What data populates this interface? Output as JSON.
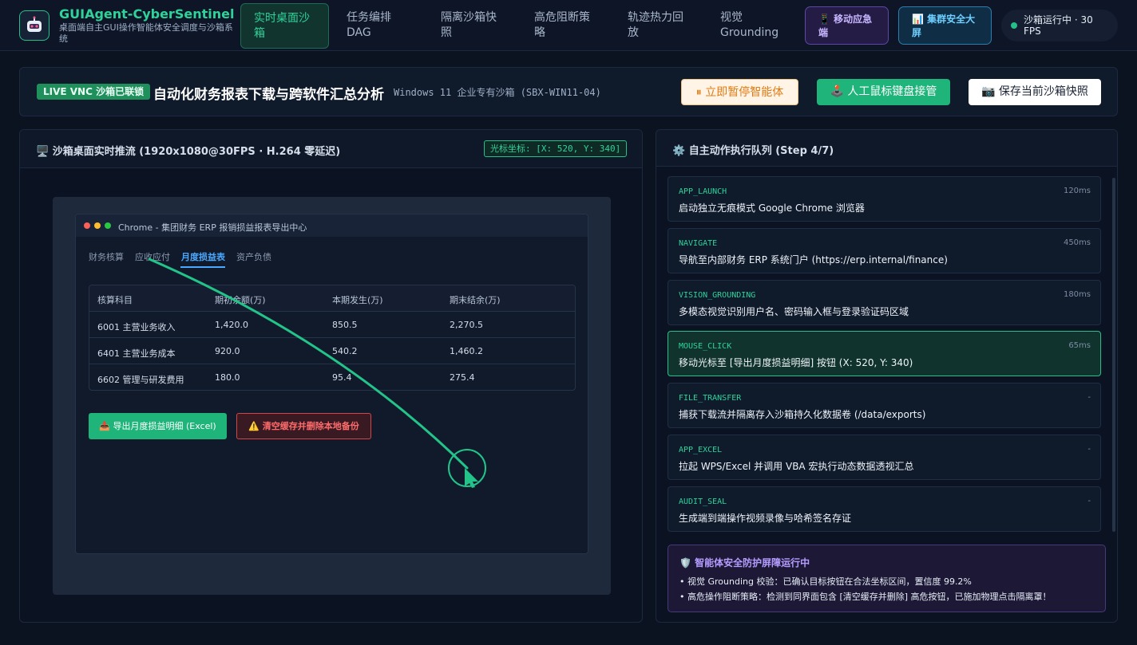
{
  "brand": {
    "title": "GUIAgent-CyberSentinel",
    "subtitle": "桌面端自主GUI操作智能体安全调度与沙箱系统"
  },
  "nav": {
    "items": [
      {
        "label": "实时桌面沙箱",
        "active": true
      },
      {
        "label": "任务编排 DAG",
        "active": false
      },
      {
        "label": "隔离沙箱快照",
        "active": false
      },
      {
        "label": "高危阻断策略",
        "active": false
      },
      {
        "label": "轨迹热力回放",
        "active": false
      },
      {
        "label": "视觉 Grounding",
        "active": false
      }
    ],
    "mobile_label": "📱 移动应急端",
    "screen_label": "📊 集群安全大屏",
    "status_text": "沙箱运行中 · 30 FPS"
  },
  "banner": {
    "live_badge": "LIVE VNC 沙箱已联锁",
    "task_title": "自动化财务报表下载与跨软件汇总分析",
    "environment": "Windows 11 企业专有沙箱 (SBX-WIN11-04)",
    "pause_label": "⏸ 立即暂停智能体",
    "takeover_label": "🕹️ 人工鼠标键盘接管",
    "snapshot_label": "📷 保存当前沙箱快照"
  },
  "stream": {
    "title": "🖥️ 沙箱桌面实时推流 (1920x1080@30FPS · H.264 零延迟)",
    "coord_badge": "光标坐标: [X: 520, Y: 340]",
    "window_title": "Chrome - 集团财务 ERP 报销损益报表导出中心",
    "tabs": [
      {
        "label": "财务核算",
        "active": false
      },
      {
        "label": "应收应付",
        "active": false
      },
      {
        "label": "月度损益表",
        "active": true
      },
      {
        "label": "资产负债",
        "active": false
      }
    ],
    "table_headers": [
      "核算科目",
      "期初余额(万)",
      "本期发生(万)",
      "期末结余(万)"
    ],
    "table_rows": [
      [
        "6001 主营业务收入",
        "1,420.0",
        "850.5",
        "2,270.5"
      ],
      [
        "6401 主营业务成本",
        "920.0",
        "540.2",
        "1,460.2"
      ],
      [
        "6602 管理与研发费用",
        "180.0",
        "95.4",
        "275.4"
      ]
    ],
    "export_button": "📥 导出月度损益明细 (Excel)",
    "danger_button": "⚠️ 清空缓存并删除本地备份"
  },
  "queue": {
    "title": "⚙️ 自主动作执行队列 (Step 4/7)",
    "items": [
      {
        "code": "APP_LAUNCH",
        "time": "120ms",
        "desc": "启动独立无痕模式 Google Chrome 浏览器",
        "active": false
      },
      {
        "code": "NAVIGATE",
        "time": "450ms",
        "desc": "导航至内部财务 ERP 系统门户 (https://erp.internal/finance)",
        "active": false
      },
      {
        "code": "VISION_GROUNDING",
        "time": "180ms",
        "desc": "多模态视觉识别用户名、密码输入框与登录验证码区域",
        "active": false
      },
      {
        "code": "MOUSE_CLICK",
        "time": "65ms",
        "desc": "移动光标至 [导出月度损益明细] 按钮 (X: 520, Y: 340)",
        "active": true
      },
      {
        "code": "FILE_TRANSFER",
        "time": "-",
        "desc": "捕获下载流并隔离存入沙箱持久化数据卷 (/data/exports)",
        "active": false
      },
      {
        "code": "APP_EXCEL",
        "time": "-",
        "desc": "拉起 WPS/Excel 并调用 VBA 宏执行动态数据透视汇总",
        "active": false
      },
      {
        "code": "AUDIT_SEAL",
        "time": "-",
        "desc": "生成端到端操作视频录像与哈希签名存证",
        "active": false
      }
    ]
  },
  "guard": {
    "title": "🛡️ 智能体安全防护屏障运行中",
    "lines": [
      "• 视觉 Grounding 校验：已确认目标按钮在合法坐标区间，置信度 99.2%",
      "• 高危操作阻断策略：检测到同界面包含 [清空缓存并删除] 高危按钮，已施加物理点击隔离罩！"
    ]
  },
  "colors": {
    "accent": "#2fd39a",
    "danger": "#ff6b6b",
    "link": "#4aa8ff",
    "purple": "#b59cff"
  }
}
